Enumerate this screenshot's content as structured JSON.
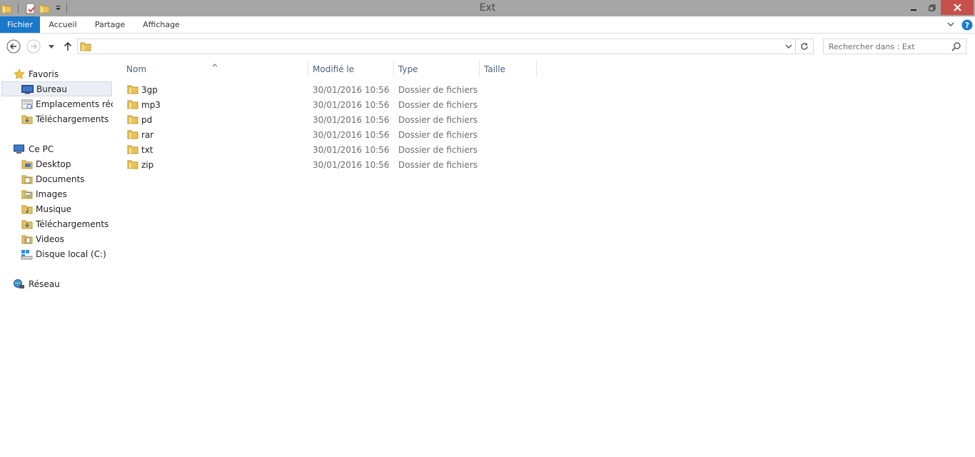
{
  "window": {
    "title": "Ext",
    "close_color": "#c7504b",
    "titlebar_color": "#a6a6a6"
  },
  "ribbon": {
    "tabs": [
      "Fichier",
      "Accueil",
      "Partage",
      "Affichage"
    ],
    "active_tab": "Fichier",
    "accent": "#1979ca"
  },
  "address": {
    "path": "",
    "search_placeholder": "Rechercher dans : Ext"
  },
  "sidebar": {
    "favorites_title": "Favoris",
    "favorites": [
      {
        "label": "Bureau",
        "icon": "desktop-icon"
      },
      {
        "label": "Emplacements récen",
        "icon": "recent-places-icon"
      },
      {
        "label": "Téléchargements",
        "icon": "downloads-folder-icon"
      }
    ],
    "pc_title": "Ce PC",
    "pc_items": [
      {
        "label": "Desktop",
        "icon": "desktop-folder-icon"
      },
      {
        "label": "Documents",
        "icon": "documents-folder-icon"
      },
      {
        "label": "Images",
        "icon": "images-folder-icon"
      },
      {
        "label": "Musique",
        "icon": "music-folder-icon"
      },
      {
        "label": "Téléchargements",
        "icon": "downloads-folder-icon"
      },
      {
        "label": "Videos",
        "icon": "videos-folder-icon"
      },
      {
        "label": "Disque local (C:)",
        "icon": "local-disk-icon"
      }
    ],
    "network_title": "Réseau"
  },
  "columns": {
    "name": "Nom",
    "modified": "Modifié le",
    "type": "Type",
    "size": "Taille"
  },
  "files": [
    {
      "name": "3gp",
      "modified": "30/01/2016 10:56",
      "type": "Dossier de fichiers",
      "size": ""
    },
    {
      "name": "mp3",
      "modified": "30/01/2016 10:56",
      "type": "Dossier de fichiers",
      "size": ""
    },
    {
      "name": "pd",
      "modified": "30/01/2016 10:56",
      "type": "Dossier de fichiers",
      "size": ""
    },
    {
      "name": "rar",
      "modified": "30/01/2016 10:56",
      "type": "Dossier de fichiers",
      "size": ""
    },
    {
      "name": "txt",
      "modified": "30/01/2016 10:56",
      "type": "Dossier de fichiers",
      "size": ""
    },
    {
      "name": "zip",
      "modified": "30/01/2016 10:56",
      "type": "Dossier de fichiers",
      "size": ""
    }
  ]
}
